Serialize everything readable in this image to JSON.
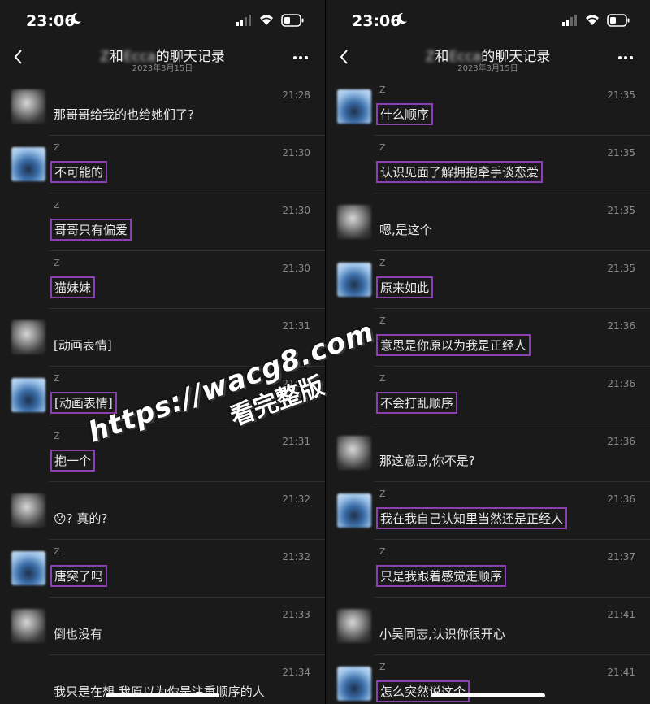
{
  "panels": [
    {
      "status": {
        "time": "23:06"
      },
      "nav": {
        "name_a": "Z",
        "name_b": "Ecca",
        "title_suffix": "的聊天记录",
        "date": "2023年3月15日"
      },
      "messages": [
        {
          "avatar": "a",
          "name": "",
          "time": "21:28",
          "text": "那哥哥给我的也给她们了?",
          "highlight": false
        },
        {
          "avatar": "b",
          "name": "Z",
          "time": "21:30",
          "text": "不可能的",
          "highlight": true
        },
        {
          "avatar": "",
          "name": "Z",
          "time": "21:30",
          "text": "哥哥只有偏爱",
          "highlight": true
        },
        {
          "avatar": "",
          "name": "Z",
          "time": "21:30",
          "text": "猫妹妹",
          "highlight": true
        },
        {
          "avatar": "a",
          "name": "",
          "time": "21:31",
          "text": "[动画表情]",
          "highlight": false
        },
        {
          "avatar": "b",
          "name": "Z",
          "time": "21:31",
          "text": "[动画表情]",
          "highlight": true
        },
        {
          "avatar": "",
          "name": "Z",
          "time": "21:31",
          "text": "抱一个",
          "highlight": true
        },
        {
          "avatar": "a",
          "name": "",
          "time": "21:32",
          "text": "😯? 真的?",
          "highlight": false
        },
        {
          "avatar": "b",
          "name": "Z",
          "time": "21:32",
          "text": "唐突了吗",
          "highlight": true
        },
        {
          "avatar": "a",
          "name": "",
          "time": "21:33",
          "text": "倒也没有",
          "highlight": false
        },
        {
          "avatar": "",
          "name": "",
          "time": "21:34",
          "text": "我只是在想,我原以为你是注重顺序的人",
          "highlight": false
        }
      ]
    },
    {
      "status": {
        "time": "23:06"
      },
      "nav": {
        "name_a": "Z",
        "name_b": "Ecca",
        "title_suffix": "的聊天记录",
        "date": "2023年3月15日"
      },
      "messages": [
        {
          "avatar": "b",
          "name": "Z",
          "time": "21:35",
          "text": "什么顺序",
          "highlight": true
        },
        {
          "avatar": "",
          "name": "Z",
          "time": "21:35",
          "text": "认识见面了解拥抱牵手谈恋爱",
          "highlight": true
        },
        {
          "avatar": "a",
          "name": "",
          "time": "21:35",
          "text": "嗯,是这个",
          "highlight": false
        },
        {
          "avatar": "b",
          "name": "Z",
          "time": "21:35",
          "text": "原来如此",
          "highlight": true
        },
        {
          "avatar": "",
          "name": "Z",
          "time": "21:36",
          "text": "意思是你原以为我是正经人",
          "highlight": true
        },
        {
          "avatar": "",
          "name": "Z",
          "time": "21:36",
          "text": "不会打乱顺序",
          "highlight": true
        },
        {
          "avatar": "a",
          "name": "",
          "time": "21:36",
          "text": "那这意思,你不是?",
          "highlight": false
        },
        {
          "avatar": "b",
          "name": "Z",
          "time": "21:36",
          "text": "我在我自己认知里当然还是正经人",
          "highlight": true
        },
        {
          "avatar": "",
          "name": "Z",
          "time": "21:37",
          "text": "只是我跟着感觉走顺序",
          "highlight": true
        },
        {
          "avatar": "a",
          "name": "",
          "time": "21:41",
          "text": "小吴同志,认识你很开心",
          "highlight": false
        },
        {
          "avatar": "b",
          "name": "Z",
          "time": "21:41",
          "text": "怎么突然说这个",
          "highlight": true
        }
      ]
    }
  ],
  "watermark": {
    "line1": "https://wacg8.com",
    "line2": "看完整版"
  },
  "colors": {
    "highlight": "#8c3fb0",
    "background": "#1a1a1a"
  },
  "icons": [
    "moon-icon",
    "signal-icon",
    "wifi-icon",
    "battery-icon",
    "back-chevron-icon",
    "more-icon"
  ]
}
